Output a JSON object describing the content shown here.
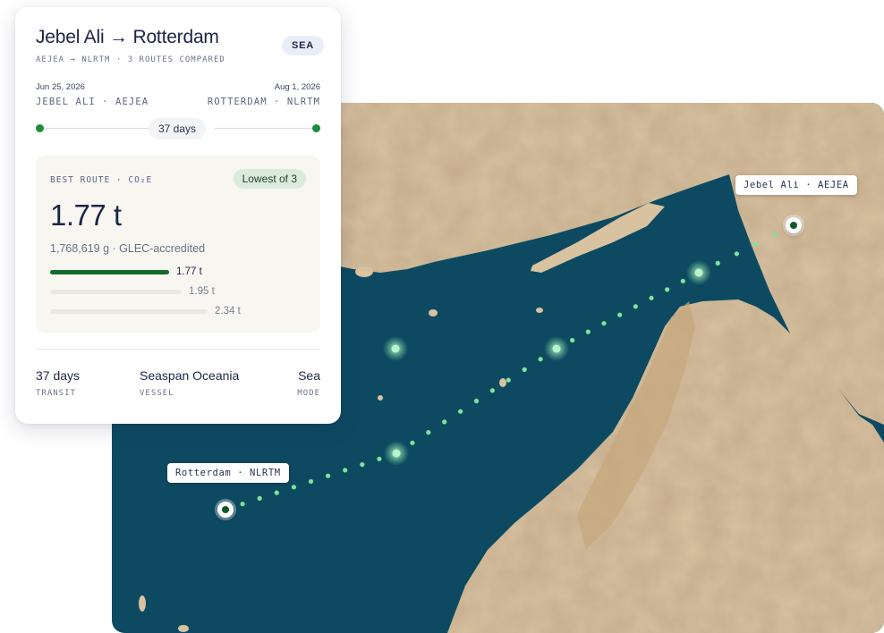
{
  "route": {
    "title": "Jebel Ali → Rotterdam",
    "mode_badge": "SEA",
    "subtitle": "AEJEA → NLRTM · 3 ROUTES COMPARED",
    "origin": {
      "date": "Jun 25, 2026",
      "port": "JEBEL ALI · AEJEA"
    },
    "destination": {
      "date": "Aug 1, 2026",
      "port": "ROTTERDAM · NLRTM"
    },
    "duration": "37 days"
  },
  "emissions": {
    "label": "BEST ROUTE · CO₂E",
    "badge": "Lowest of 3",
    "value": "1.77 t",
    "detail": "1,768,619 g · GLEC-accredited",
    "routes": [
      {
        "label": "1.77 t",
        "share": 0.756,
        "best": true
      },
      {
        "label": "1.95 t",
        "share": 0.833,
        "best": false
      },
      {
        "label": "2.34 t",
        "share": 1.0,
        "best": false
      }
    ]
  },
  "stats": [
    {
      "value": "37 days",
      "key": "TRANSIT"
    },
    {
      "value": "Seaspan Oceania",
      "key": "VESSEL"
    },
    {
      "value": "Sea",
      "key": "MODE"
    }
  ],
  "map": {
    "origin_label": "Jebel Ali · AEJEA",
    "destination_label": "Rotterdam · NLRTM",
    "colors": {
      "sea": "#0d4a62",
      "land": "#d8c2a0",
      "route": "#7fe39a",
      "pin": "#0f5a2a"
    }
  }
}
